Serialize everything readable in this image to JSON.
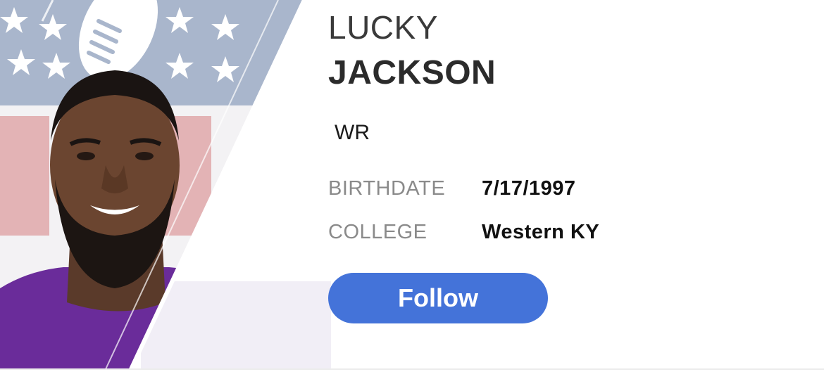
{
  "player": {
    "first_name": "LUCKY",
    "last_name": "JACKSON",
    "position": "WR",
    "birthdate_label": "BIRTHDATE",
    "birthdate_value": "7/17/1997",
    "college_label": "COLLEGE",
    "college_value": "Western KY"
  },
  "actions": {
    "follow_label": "Follow"
  },
  "colors": {
    "accent": "#4473d9",
    "jersey": "#6a2c9a",
    "shield_blue": "#a9b6cc",
    "shield_red": "#e3b3b5"
  }
}
